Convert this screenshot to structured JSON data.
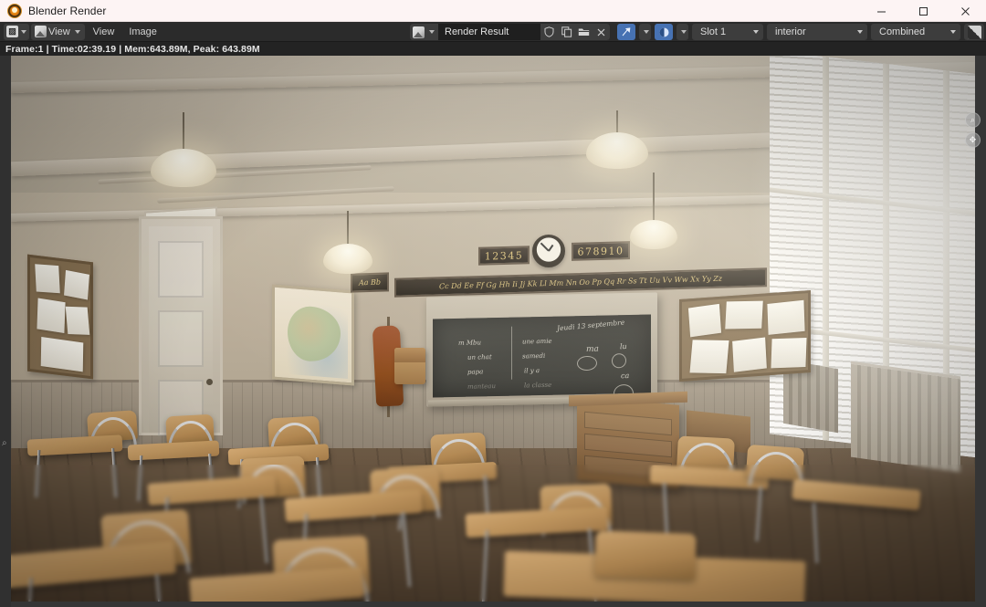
{
  "window": {
    "title": "Blender Render",
    "app_icon": "blender-logo-icon",
    "controls": {
      "minimize": "minimize-icon",
      "maximize": "maximize-icon",
      "close": "close-icon"
    }
  },
  "header": {
    "editor_type_icon": "image-editor-icon",
    "view_mode_icon": "image-view-icon",
    "view_mode_label": "View",
    "menus": [
      {
        "label": "View"
      },
      {
        "label": "Image"
      }
    ],
    "datablock": {
      "icon": "image-datablock-icon",
      "name": "Render Result",
      "tools": [
        {
          "icon": "shield-icon",
          "name": "fake-user-button"
        },
        {
          "icon": "copy-icon",
          "name": "new-image-button"
        },
        {
          "icon": "folder-icon",
          "name": "open-image-button"
        },
        {
          "icon": "close-icon",
          "name": "unlink-datablock-button"
        }
      ]
    },
    "right": {
      "pin_icon": "pin-cursor-icon",
      "display_icon": "display-channels-icon",
      "slot": "Slot 1",
      "view_layer": "interior",
      "pass": "Combined",
      "alpha_icon": "alpha-display-icon"
    }
  },
  "status": {
    "text": "Frame:1 | Time:02:39.19 | Mem:643.89M, Peak: 643.89M",
    "frame": "Frame:1",
    "time": "Time:02:39.19",
    "memory": "Mem:643.89M",
    "peak": "Peak: 643.89M"
  },
  "viewport": {
    "sidebar_toggle_icon": "chevron-right-icon",
    "gizmos": [
      {
        "name": "zoom-gizmo",
        "glyph": "⌕"
      },
      {
        "name": "pan-gizmo",
        "glyph": "✥"
      }
    ]
  },
  "scene": {
    "description": "Rendered 3D classroom interior",
    "chalkboard": {
      "date": "Jeudi 13 septembre",
      "column_one": [
        "m  Mbu",
        "un chat",
        "papa",
        "manteau"
      ],
      "column_two": [
        "une amie",
        "samedi",
        "il y a",
        "la classe"
      ],
      "notes": [
        "ma",
        "lu",
        "ca"
      ]
    },
    "number_plaques": [
      "12345",
      "678910"
    ],
    "alphabet_left": "Aa Bb",
    "alphabet_strip": "Cc Dd Ee Ff Gg Hh Ii Jj Kk Ll Mm Nn Oo Pp Qq Rr Ss Tt Uu Vv Ww Xx Yy Zz",
    "colors": {
      "wall": "#bcb09c",
      "wainscot": "#9a8f7e",
      "floor": "#5c4b39",
      "board": "#3b3b36",
      "wood": "#c49a62",
      "accent_blue": "#4772b3",
      "header_bg": "#2b2b2b",
      "titlebar_bg": "#fdf4f4"
    }
  }
}
